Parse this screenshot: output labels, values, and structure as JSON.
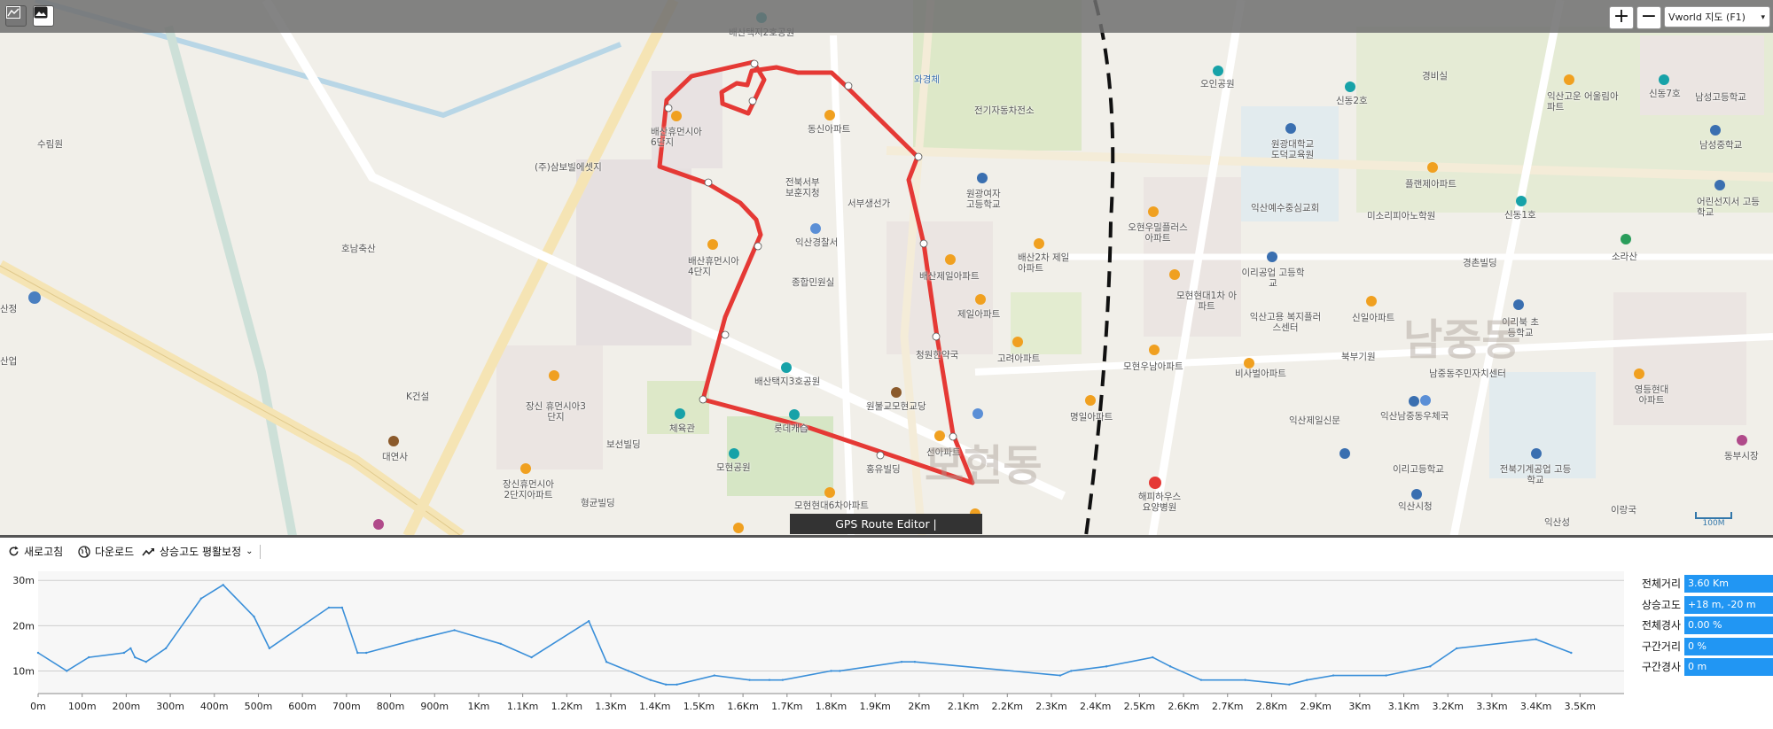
{
  "app": {
    "credit": "GPS Route Editor | www.gpsnote.net"
  },
  "topbar": {
    "icons": [
      "chart-toggle-icon",
      "image-icon"
    ],
    "zoom_in": "+",
    "zoom_out": "−",
    "map_select": "Vworld 지도 (F1)"
  },
  "map": {
    "scale_label": "100M",
    "labels": {
      "l1": "배산택지2호공원",
      "l2": "오인공원",
      "l3": "신동2호",
      "l4": "경비실",
      "l5": "익산고운 어울림아파트",
      "l6": "신동7호",
      "l7": "남성고등학교",
      "l8": "남성중학교",
      "l9": "어린선지서 고등학교",
      "l10": "수림원",
      "l11": "(주)삼보빌에셋지",
      "l12": "와경체",
      "l13": "전기자동차전소",
      "l14": "동신아파트",
      "l15": "배산휴먼시아 6단지",
      "l16": "전북서부 보훈지청",
      "l17": "서부생선가",
      "l18": "원광여자 고등학교",
      "l19": "익산경찰서",
      "l20": "배산휴먼시아 4단지",
      "l21": "종합민원실",
      "l22": "배산제일아파트",
      "l23": "배산2차 제일아파트",
      "l24": "제일아파트",
      "l25": "호남축산",
      "l26": "산정",
      "l27": "산업",
      "l28": "K건설",
      "l29": "대연사",
      "l30": "장신 휴먼시아3단지",
      "l31": "장신휴먼시아 2단지아파트",
      "l32": "체육관",
      "l33": "배산택지3호공원",
      "l34": "롯데캐슬",
      "l35": "보선빌딩",
      "l36": "모현공원",
      "l37": "형균빌딩",
      "l38": "모현현대6차아파트",
      "l39": "선아파트",
      "l40": "홍유빌딩",
      "l41": "원불교모현교당",
      "l42": "청원한약국",
      "l43": "고려아파트",
      "l44": "명일아파트",
      "l45": "모현동",
      "l46": "오현우밀플러스 아파트",
      "l47": "모현현대1차 아파트",
      "l48": "모현우남아파트",
      "l49": "해피하우스 요양병원",
      "l50": "익산예수중심교회",
      "l51": "원광대학교 도덕교육원",
      "l52": "플랜제아파트",
      "l53": "미소리피아노학원",
      "l54": "신동1호",
      "l55": "이리공업 고등학교",
      "l56": "익산고용 복지플러스센터",
      "l57": "신일아파트",
      "l58": "경촌빌딩",
      "l59": "이리북 초등학교",
      "l60": "소라산",
      "l61": "비사벌아파트",
      "l62": "북부기원",
      "l63": "남중동",
      "l64": "남중동주민자치센터",
      "l65": "영등현대 아파트",
      "l66": "익산제일신문",
      "l67": "익산남중동우체국",
      "l68": "동부시장",
      "l69": "이리고등학교",
      "l70": "전북기계공업 고등학교",
      "l71": "익산시청",
      "l72": "이랑국",
      "l73": "익산성"
    }
  },
  "toolbar": {
    "refresh": "새로고침",
    "download": "다운로드",
    "smoothing": "상승고도 평활보정"
  },
  "stats": [
    {
      "label": "전체거리",
      "value": "3.60 Km"
    },
    {
      "label": "상승고도",
      "value": "+18 m, -20 m"
    },
    {
      "label": "전체경사",
      "value": "0.00 %"
    },
    {
      "label": "구간거리",
      "value": "0 %"
    },
    {
      "label": "구간경사",
      "value": "0 m"
    }
  ],
  "colors": {
    "route": "#e53935",
    "series": "#3a8fd9",
    "stat_bg": "#2196f3"
  },
  "chart_data": {
    "type": "line",
    "ylabels": [
      "30m",
      "20m",
      "10m"
    ],
    "yticks": [
      30,
      20,
      10
    ],
    "ylim": [
      5,
      32
    ],
    "xlim": [
      0,
      3600
    ],
    "xticks": [
      0,
      100,
      200,
      300,
      400,
      500,
      600,
      700,
      800,
      900,
      1000,
      1100,
      1200,
      1300,
      1400,
      1500,
      1600,
      1700,
      1800,
      1900,
      2000,
      2100,
      2200,
      2300,
      2400,
      2500,
      2600,
      2700,
      2800,
      2900,
      3000,
      3100,
      3200,
      3300,
      3400,
      3500
    ],
    "xlabels": [
      "0m",
      "100m",
      "200m",
      "300m",
      "400m",
      "500m",
      "600m",
      "700m",
      "800m",
      "900m",
      "1Km",
      "1.1Km",
      "1.2Km",
      "1.3Km",
      "1.4Km",
      "1.5Km",
      "1.6Km",
      "1.7Km",
      "1.8Km",
      "1.9Km",
      "2Km",
      "2.1Km",
      "2.2Km",
      "2.3Km",
      "2.4Km",
      "2.5Km",
      "2.6Km",
      "2.7Km",
      "2.8Km",
      "2.9Km",
      "3Km",
      "3.1Km",
      "3.2Km",
      "3.3Km",
      "3.4Km",
      "3.5Km"
    ],
    "x": [
      0,
      65,
      115,
      195,
      210,
      220,
      245,
      290,
      370,
      420,
      490,
      525,
      660,
      690,
      725,
      745,
      860,
      945,
      1050,
      1120,
      1250,
      1290,
      1340,
      1390,
      1425,
      1450,
      1535,
      1615,
      1660,
      1690,
      1800,
      1820,
      1960,
      1990,
      2320,
      2345,
      2425,
      2530,
      2570,
      2640,
      2740,
      2840,
      2880,
      2940,
      3060,
      3160,
      3220,
      3400,
      3480
    ],
    "y": [
      14,
      10,
      13,
      14,
      15,
      13,
      12,
      15,
      26,
      29,
      22,
      15,
      24,
      24,
      14,
      14,
      17,
      19,
      16,
      13,
      21,
      12,
      10,
      8,
      7,
      7,
      9,
      8,
      8,
      8,
      10,
      10,
      12,
      12,
      9,
      10,
      11,
      13,
      11,
      8,
      8,
      7,
      8,
      9,
      9,
      11,
      15,
      17,
      14
    ]
  }
}
